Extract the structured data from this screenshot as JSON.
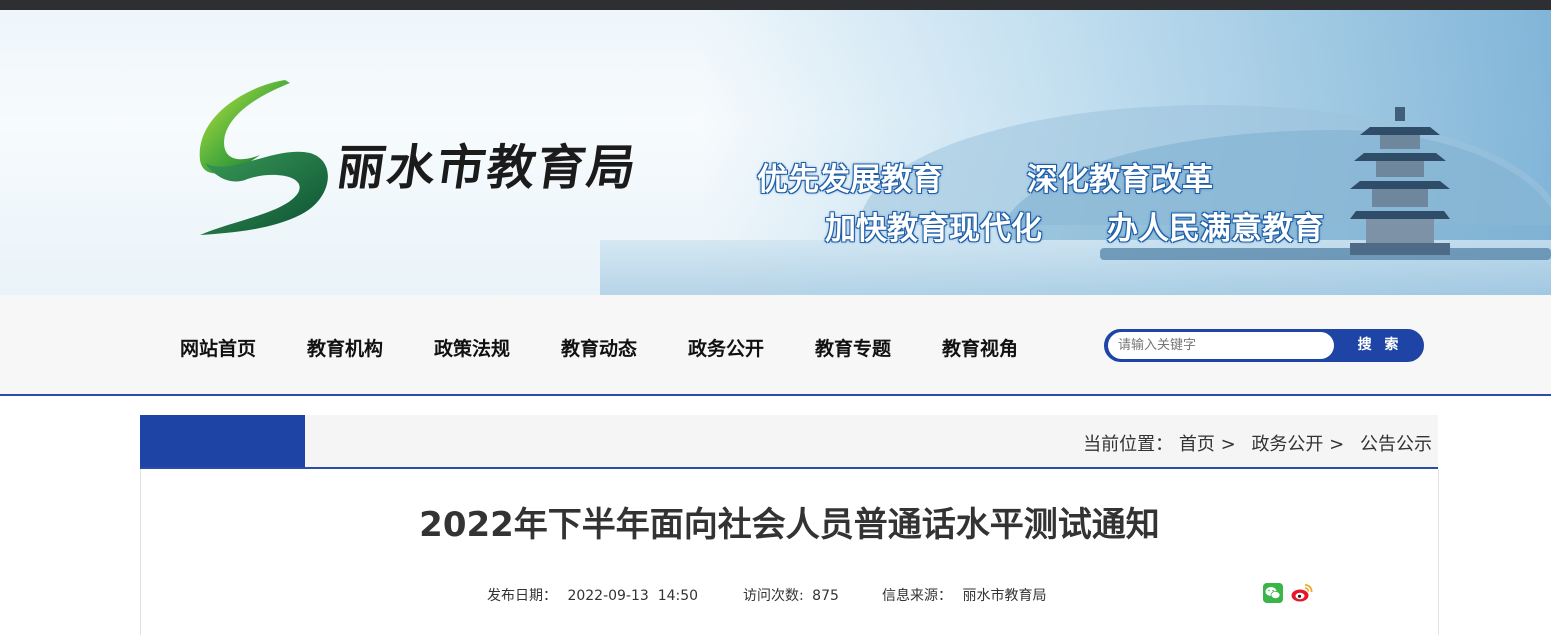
{
  "header": {
    "site_name": "丽水市教育局",
    "slogans": [
      "优先发展教育",
      "深化教育改革",
      "加快教育现代化",
      "办人民满意教育"
    ]
  },
  "nav": {
    "items": [
      "网站首页",
      "教育机构",
      "政策法规",
      "教育动态",
      "政务公开",
      "教育专题",
      "教育视角"
    ],
    "search": {
      "placeholder": "请输入关键字",
      "button_label": "搜 索"
    }
  },
  "breadcrumb": {
    "prefix": "当前位置：",
    "items": [
      "首页",
      "政务公开",
      "公告公示"
    ],
    "separator": ">"
  },
  "article": {
    "title": "2022年下半年面向社会人员普通话水平测试通知",
    "publish_label": "发布日期：",
    "publish_date": "2022-09-13  14:50",
    "visits_label": "访问次数:",
    "visits": "875",
    "source_label": "信息来源：",
    "source": "丽水市教育局"
  },
  "icons": {
    "logo": "lishui-logo-icon",
    "share": [
      "wechat-icon",
      "weibo-icon"
    ]
  },
  "colors": {
    "accent": "#1e45a6",
    "topbar": "#2d2f33",
    "slogan_outline": "#1f5fa8",
    "wechat": "#3bb54a",
    "weibo": "#e6162d"
  }
}
